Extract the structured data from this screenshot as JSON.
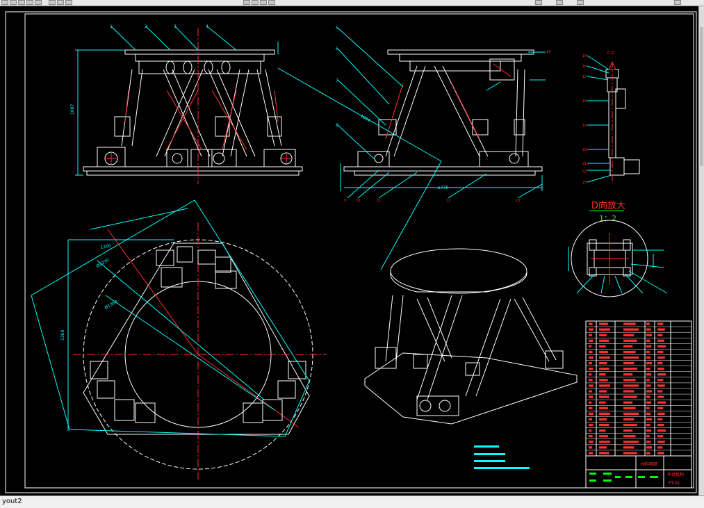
{
  "window": {
    "layout_tab_label": "yout2",
    "canvas_bg": "#000000",
    "colors": {
      "drawing": "#ffffff",
      "dimension": "#00ffff",
      "center": "#ff0000",
      "title": "#ff0000",
      "scale": "#00ff00"
    }
  },
  "drawing": {
    "detail_title": "D向放大",
    "detail_scale": "1：2",
    "section_label": "C-C",
    "dim_height": "1087",
    "dim_width": "1770",
    "dim_triangle": "1200",
    "dim_diag": "1004",
    "dim_circle_outer": "Ø2230",
    "dim_circle_inner": "Ø1360",
    "dim_height2": "1360",
    "part_numbers_front": [
      "1",
      "2",
      "3",
      "4"
    ],
    "part_numbers_side_top": [
      "5",
      "6",
      "7",
      "8"
    ],
    "part_numbers_side_bottom": [
      "9",
      "10",
      "11",
      "12",
      "13",
      "14"
    ],
    "part_numbers_right": [
      "15",
      "16",
      "17",
      "18",
      "19",
      "20",
      "21",
      "22",
      "23"
    ],
    "bom_title": "材料明细",
    "bom_name": "平台机构",
    "bom_code": "PT-01"
  }
}
